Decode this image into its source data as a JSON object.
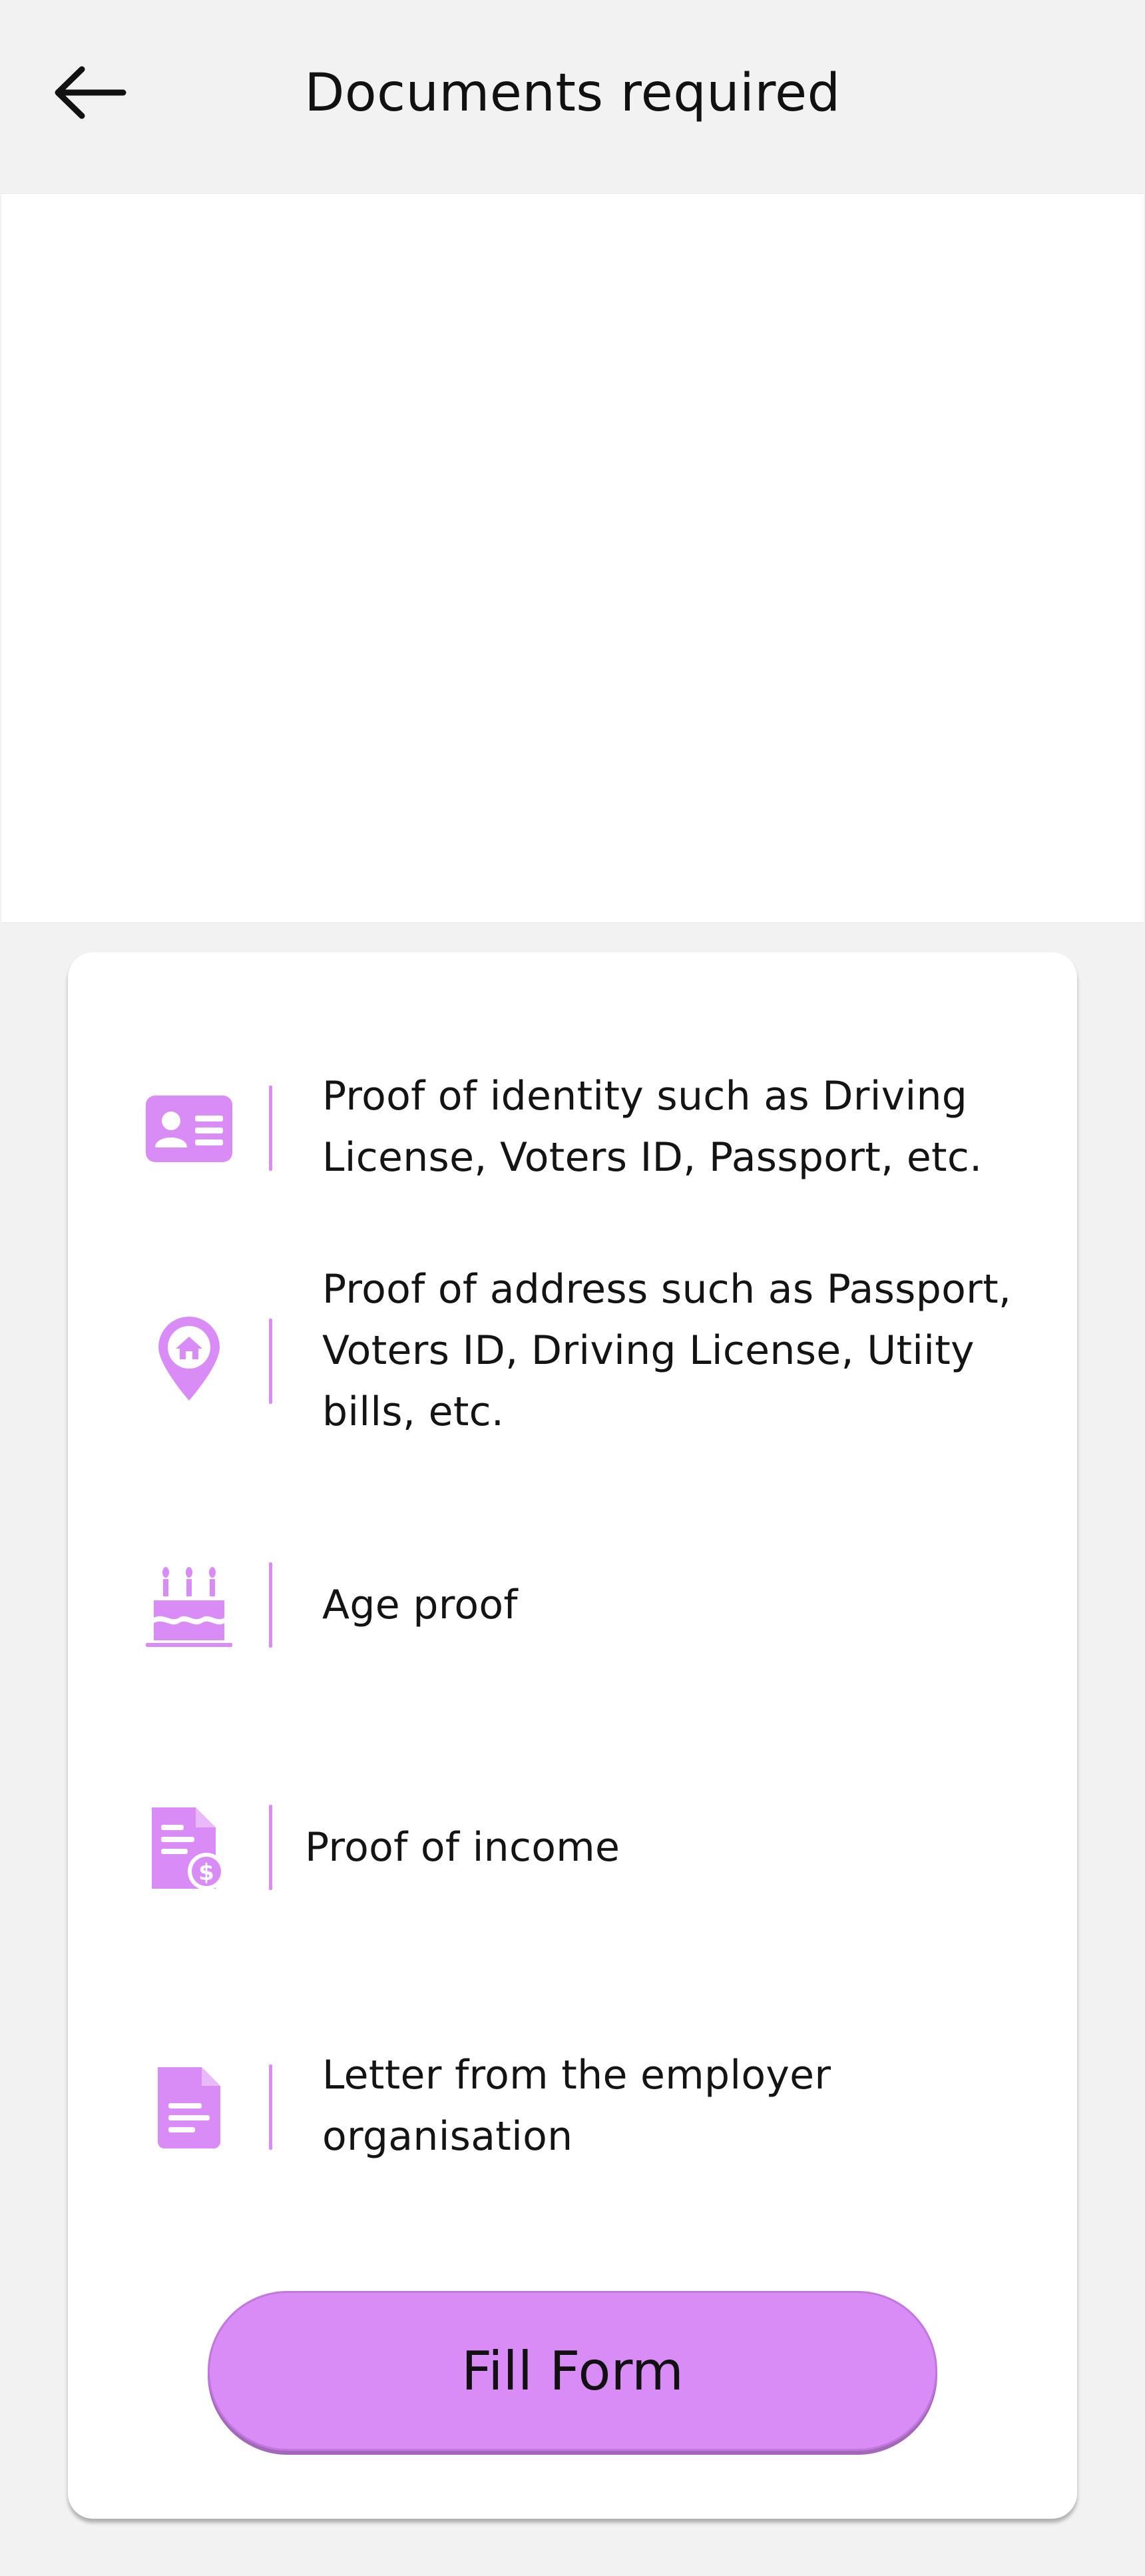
{
  "header": {
    "title": "Documents required",
    "back_icon": "arrow-left-icon"
  },
  "documents": [
    {
      "icon": "id-card-icon",
      "text": "Proof of identity such as Driving License, Voters ID, Passport, etc."
    },
    {
      "icon": "location-home-icon",
      "text": "Proof of address such as Passport, Voters ID, Driving License, Utiity bills, etc."
    },
    {
      "icon": "birthday-cake-icon",
      "text": "Age proof"
    },
    {
      "icon": "income-document-icon",
      "text": "Proof of income"
    },
    {
      "icon": "letter-document-icon",
      "text": "Letter from the employer organisation"
    }
  ],
  "cta": {
    "label": "Fill Form"
  },
  "colors": {
    "accent": "#d98cf6",
    "background": "#f2f2f2",
    "card": "#ffffff",
    "text": "#111111"
  }
}
